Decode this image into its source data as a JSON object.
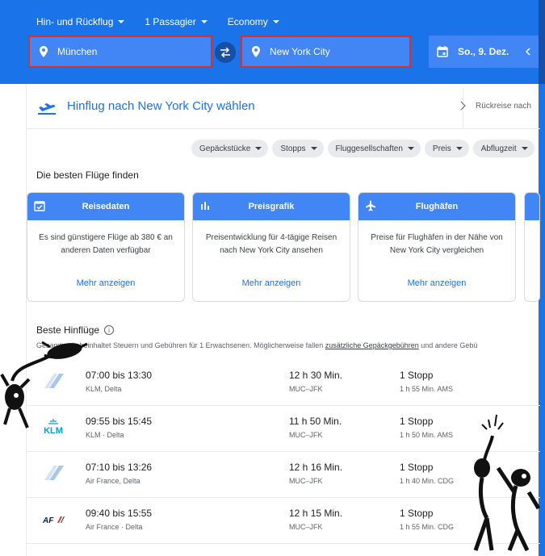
{
  "header": {
    "trip_type": "Hin- und Rückflug",
    "passengers": "1 Passagier",
    "cabin": "Economy",
    "from": "München",
    "to": "New York City",
    "date": "So., 9. Dez."
  },
  "subheader": {
    "title": "Hinflug nach New York City wählen",
    "return_text": "Rückreise nach"
  },
  "filters": [
    "Gepäckstücke",
    "Stopps",
    "Fluggesellschaften",
    "Preis",
    "Abflugzeit"
  ],
  "best_section_title": "Die besten Flüge finden",
  "cards": [
    {
      "title": "Reisedaten",
      "body": "Es sind günstigere Flüge ab 380 € an anderen Daten verfügbar",
      "link": "Mehr anzeigen"
    },
    {
      "title": "Preisgrafik",
      "body": "Preisentwicklung für 4-tägige Reisen nach New York City ansehen",
      "link": "Mehr anzeigen"
    },
    {
      "title": "Flughäfen",
      "body": "Preise für Flughäfen in der Nähe von New York City vergleichen",
      "link": "Mehr anzeigen"
    }
  ],
  "results": {
    "title": "Beste Hinflüge",
    "note_prefix": "Gesamtpreis beinhaltet Steuern und Gebühren für 1 Erwachsenen. Möglicherweise fallen ",
    "note_link": "zusätzliche Gepäckgebühren",
    "note_suffix": " und andere Gebü"
  },
  "flights": [
    {
      "times": "07:00 bis 13:30",
      "airline": "KLM, Delta",
      "duration": "12 h 30 Min.",
      "route": "MUC–JFK",
      "stops": "1 Stopp",
      "layover": "1 h 55 Min. AMS",
      "logo": "delta-tail-logo"
    },
    {
      "times": "09:55 bis 15:45",
      "airline": "KLM · Delta",
      "duration": "11 h 50 Min.",
      "route": "MUC–JFK",
      "stops": "1 Stopp",
      "layover": "1 h 50 Min. AMS",
      "logo": "klm-logo"
    },
    {
      "times": "07:10 bis 13:26",
      "airline": "Air France, Delta",
      "duration": "12 h 16 Min.",
      "route": "MUC–JFK",
      "stops": "1 Stopp",
      "layover": "1 h 40 Min. CDG",
      "logo": "delta-tail-logo"
    },
    {
      "times": "09:40 bis 15:55",
      "airline": "Air France · Delta",
      "duration": "12 h 15 Min.",
      "route": "MUC–JFK",
      "stops": "1 Stopp",
      "layover": "1 h 55 Min. CDG",
      "logo": "air-france-logo"
    }
  ],
  "colors": {
    "primary": "#1a73e8",
    "field": "#4285f4",
    "highlight": "#d93025"
  }
}
